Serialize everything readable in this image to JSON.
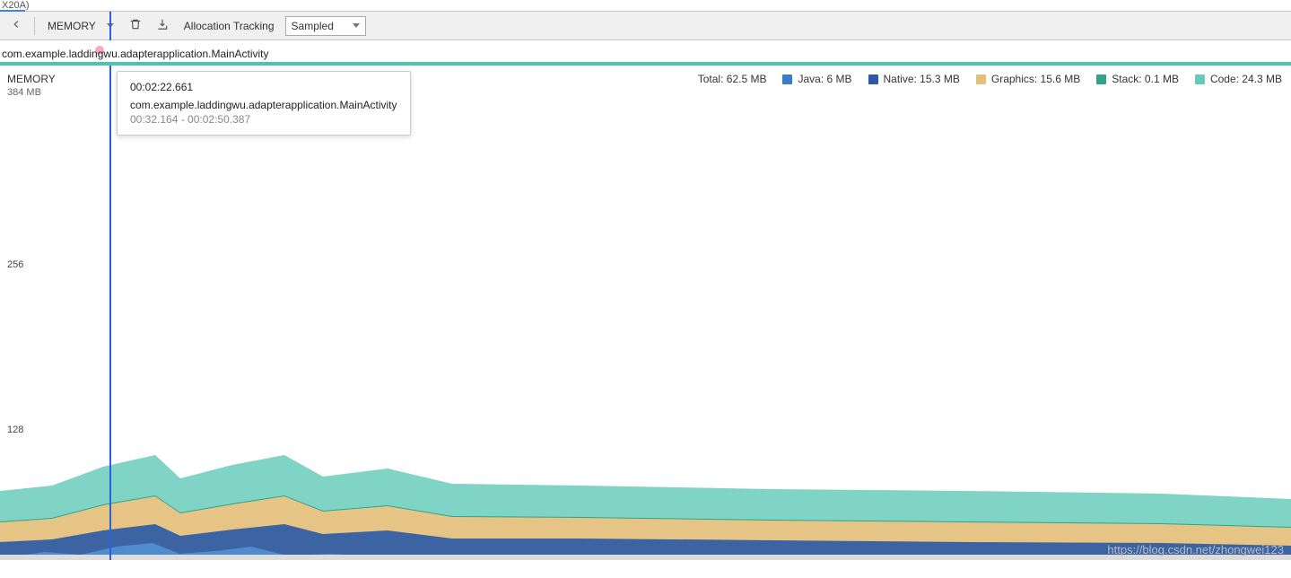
{
  "window": {
    "tab": "X20A)"
  },
  "toolbar": {
    "profiler": "MEMORY",
    "allocation_label": "Allocation Tracking",
    "sampling_mode": "Sampled"
  },
  "timeline": {
    "activity": "com.example.laddingwu.adapterapplication.MainActivity"
  },
  "chart": {
    "title": "MEMORY",
    "y_max_label": "384 MB",
    "ticks": [
      "256",
      "128"
    ]
  },
  "legend": {
    "total": "Total: 62.5 MB",
    "items": [
      {
        "name": "Java",
        "label": "Java: 6 MB",
        "color": "#3a7cc9"
      },
      {
        "name": "Native",
        "label": "Native: 15.3 MB",
        "color": "#2d5aa8"
      },
      {
        "name": "Graphics",
        "label": "Graphics: 15.6 MB",
        "color": "#e5bf7a"
      },
      {
        "name": "Stack",
        "label": "Stack: 0.1 MB",
        "color": "#2fa38c"
      },
      {
        "name": "Code",
        "label": "Code: 24.3 MB",
        "color": "#66cbb9"
      }
    ]
  },
  "tooltip": {
    "time": "00:02:22.661",
    "activity": "com.example.laddingwu.adapterapplication.MainActivity",
    "range": "00:32.164 - 00:02:50.387"
  },
  "watermark": "https://blog.csdn.net/zhongwei123",
  "chart_data": {
    "type": "area",
    "title": "MEMORY",
    "ylabel": "MB",
    "ylim": [
      0,
      384
    ],
    "x_unit": "fraction_of_timeline",
    "series": [
      {
        "name": "Java",
        "color": "#3a7cc9",
        "approx_mb": 6.0
      },
      {
        "name": "Native",
        "color": "#2d5aa8",
        "approx_mb": 15.3
      },
      {
        "name": "Graphics",
        "color": "#e5bf7a",
        "approx_mb": 15.6
      },
      {
        "name": "Stack",
        "color": "#2fa38c",
        "approx_mb": 0.1
      },
      {
        "name": "Code",
        "color": "#66cbb9",
        "approx_mb": 24.3
      }
    ],
    "total_mb": 62.5,
    "stacked_top_profile": [
      {
        "x": 0.0,
        "mb": 54
      },
      {
        "x": 0.04,
        "mb": 58
      },
      {
        "x": 0.08,
        "mb": 73
      },
      {
        "x": 0.12,
        "mb": 82
      },
      {
        "x": 0.14,
        "mb": 64
      },
      {
        "x": 0.18,
        "mb": 74
      },
      {
        "x": 0.22,
        "mb": 82
      },
      {
        "x": 0.25,
        "mb": 66
      },
      {
        "x": 0.3,
        "mb": 72
      },
      {
        "x": 0.35,
        "mb": 60
      },
      {
        "x": 0.45,
        "mb": 58
      },
      {
        "x": 0.6,
        "mb": 56
      },
      {
        "x": 0.75,
        "mb": 54
      },
      {
        "x": 0.9,
        "mb": 52
      },
      {
        "x": 1.0,
        "mb": 48
      }
    ],
    "cursor_time": "00:02:22.661"
  }
}
